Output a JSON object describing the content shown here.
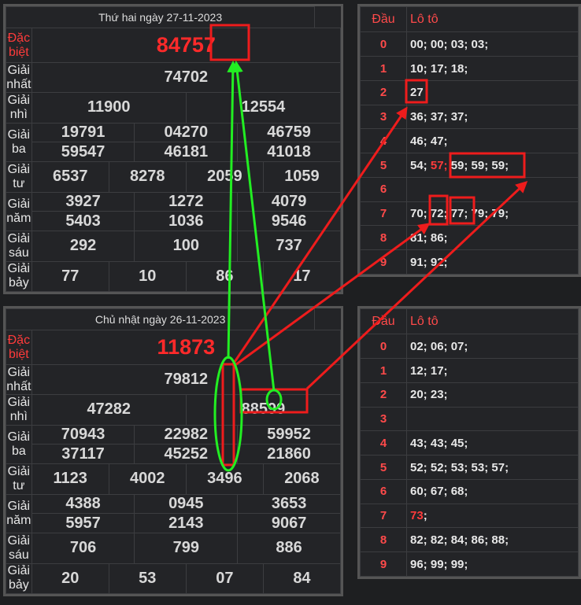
{
  "top": {
    "title": "Thứ hai ngày 27-11-2023",
    "labels": {
      "db": "Đặc biệt",
      "g1": "Giải nhất",
      "g2": "Giải nhì",
      "g3": "Giải ba",
      "g4": "Giải tư",
      "g5": "Giải năm",
      "g6": "Giải sáu",
      "g7": "Giải bảy"
    },
    "db": "84757",
    "g1": "74702",
    "g2": [
      "11900",
      "12554"
    ],
    "g3": [
      "19791",
      "04270",
      "46759",
      "59547",
      "46181",
      "41018"
    ],
    "g4": [
      "6537",
      "8278",
      "2059",
      "1059"
    ],
    "g5": [
      "3927",
      "1272",
      "4079",
      "5403",
      "1036",
      "9546"
    ],
    "g6": [
      "292",
      "100",
      "737"
    ],
    "g7": [
      "77",
      "10",
      "86",
      "17"
    ]
  },
  "bottom": {
    "title": "Chủ nhật ngày 26-11-2023",
    "labels": {
      "db": "Đặc biệt",
      "g1": "Giải nhất",
      "g2": "Giải nhì",
      "g3": "Giải ba",
      "g4": "Giải tư",
      "g5": "Giải năm",
      "g6": "Giải sáu",
      "g7": "Giải bảy"
    },
    "db": "11873",
    "g1": "79812",
    "g2": [
      "47282",
      "88599"
    ],
    "g3": [
      "70943",
      "22982",
      "59952",
      "37117",
      "45252",
      "21860"
    ],
    "g4": [
      "1123",
      "4002",
      "3496",
      "2068"
    ],
    "g5": [
      "4388",
      "0945",
      "3653",
      "5957",
      "2143",
      "9067"
    ],
    "g6": [
      "706",
      "799",
      "886"
    ],
    "g7": [
      "20",
      "53",
      "07",
      "84"
    ]
  },
  "loto_top": {
    "head_dau": "Đầu",
    "head_loto": "Lô tô",
    "rows": [
      {
        "d": "0",
        "v": "00; 00; 03; 03;"
      },
      {
        "d": "1",
        "v": "10; 17; 18;"
      },
      {
        "d": "2",
        "v": "27"
      },
      {
        "d": "3",
        "v": "36; 37; 37;"
      },
      {
        "d": "4",
        "v": "46; 47;"
      },
      {
        "d": "5",
        "v_pre": "54; ",
        "v_hl": "57;",
        "v_post": " 59; 59; 59;"
      },
      {
        "d": "6",
        "v": ""
      },
      {
        "d": "7",
        "v": "70; 72; 77; 79; 79;"
      },
      {
        "d": "8",
        "v": "81; 86;"
      },
      {
        "d": "9",
        "v": "91; 92;"
      }
    ]
  },
  "loto_bottom": {
    "head_dau": "Đầu",
    "head_loto": "Lô tô",
    "rows": [
      {
        "d": "0",
        "v": "02; 06; 07;"
      },
      {
        "d": "1",
        "v": "12; 17;"
      },
      {
        "d": "2",
        "v": "20; 23;"
      },
      {
        "d": "3",
        "v": ""
      },
      {
        "d": "4",
        "v": "43; 43; 45;"
      },
      {
        "d": "5",
        "v": "52; 52; 53; 53; 57;"
      },
      {
        "d": "6",
        "v": "60; 67; 68;"
      },
      {
        "d": "7",
        "v_hl": "73",
        "v_post": ";"
      },
      {
        "d": "8",
        "v": "82; 82; 84; 86; 88;"
      },
      {
        "d": "9",
        "v": "96; 99; 99;"
      }
    ]
  },
  "colors": {
    "annotation_red": "#ee1c1c",
    "annotation_green": "#22ee22",
    "special_red": "#ff2a2a"
  }
}
